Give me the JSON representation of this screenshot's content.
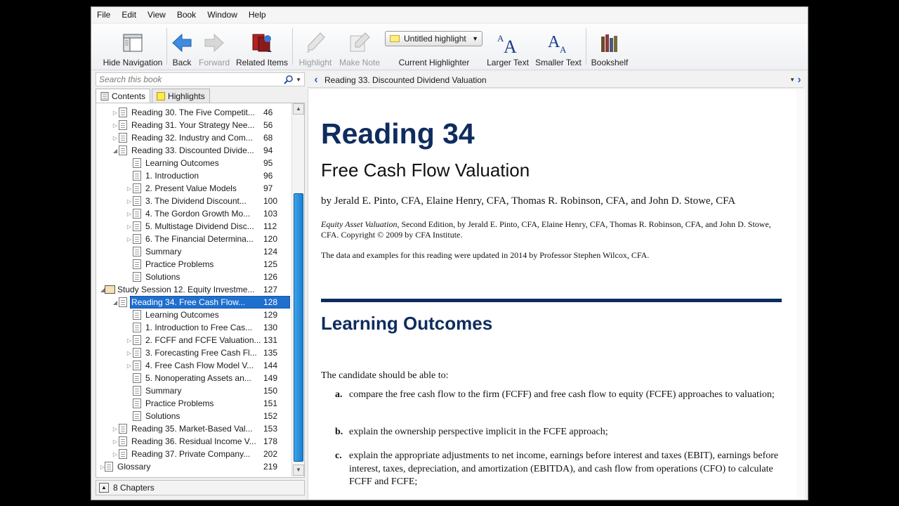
{
  "menu": [
    "File",
    "Edit",
    "View",
    "Book",
    "Window",
    "Help"
  ],
  "toolbar": {
    "hide_navigation": "Hide Navigation",
    "back": "Back",
    "forward": "Forward",
    "related_items": "Related Items",
    "highlight": "Highlight",
    "make_note": "Make Note",
    "highlighter_value": "Untitled highlight",
    "current_highlighter": "Current Highlighter",
    "larger_text": "Larger Text",
    "smaller_text": "Smaller Text",
    "bookshelf": "Bookshelf"
  },
  "sidebar": {
    "search_placeholder": "Search this book",
    "tabs": [
      "Contents",
      "Highlights"
    ],
    "status": "8 Chapters",
    "rows": [
      {
        "label": "Reading 30. The Five Competit...",
        "page": "46",
        "level": 2,
        "exp": "▷"
      },
      {
        "label": "Reading 31. Your Strategy Nee...",
        "page": "56",
        "level": 2,
        "exp": "▷"
      },
      {
        "label": "Reading 32. Industry and Com...",
        "page": "68",
        "level": 2,
        "exp": "▷"
      },
      {
        "label": "Reading 33. Discounted Divide...",
        "page": "94",
        "level": 2,
        "exp": "◢"
      },
      {
        "label": "Learning Outcomes",
        "page": "95",
        "level": 3,
        "exp": ""
      },
      {
        "label": "1. Introduction",
        "page": "96",
        "level": 3,
        "exp": ""
      },
      {
        "label": "2. Present Value Models",
        "page": "97",
        "level": 3,
        "exp": "▷"
      },
      {
        "label": "3. The Dividend Discount...",
        "page": "100",
        "level": 3,
        "exp": "▷"
      },
      {
        "label": "4. The Gordon Growth Mo...",
        "page": "103",
        "level": 3,
        "exp": "▷"
      },
      {
        "label": "5. Multistage Dividend Disc...",
        "page": "112",
        "level": 3,
        "exp": "▷"
      },
      {
        "label": "6. The Financial Determina...",
        "page": "120",
        "level": 3,
        "exp": "▷"
      },
      {
        "label": "Summary",
        "page": "124",
        "level": 3,
        "exp": ""
      },
      {
        "label": "Practice Problems",
        "page": "125",
        "level": 3,
        "exp": ""
      },
      {
        "label": "Solutions",
        "page": "126",
        "level": 3,
        "exp": ""
      },
      {
        "label": "Study Session 12. Equity Investme...",
        "page": "127",
        "level": 1,
        "exp": "◢",
        "book": true
      },
      {
        "label": "Reading 34. Free Cash Flow...",
        "page": "128",
        "level": 2,
        "exp": "◢",
        "selected": true
      },
      {
        "label": "Learning Outcomes",
        "page": "129",
        "level": 3,
        "exp": ""
      },
      {
        "label": "1. Introduction to Free Cas...",
        "page": "130",
        "level": 3,
        "exp": ""
      },
      {
        "label": "2. FCFF and FCFE Valuation...",
        "page": "131",
        "level": 3,
        "exp": "▷"
      },
      {
        "label": "3. Forecasting Free Cash Fl...",
        "page": "135",
        "level": 3,
        "exp": "▷"
      },
      {
        "label": "4. Free Cash Flow Model V...",
        "page": "144",
        "level": 3,
        "exp": "▷"
      },
      {
        "label": "5. Nonoperating Assets an...",
        "page": "149",
        "level": 3,
        "exp": ""
      },
      {
        "label": "Summary",
        "page": "150",
        "level": 3,
        "exp": ""
      },
      {
        "label": "Practice Problems",
        "page": "151",
        "level": 3,
        "exp": ""
      },
      {
        "label": "Solutions",
        "page": "152",
        "level": 3,
        "exp": ""
      },
      {
        "label": "Reading 35. Market-Based Val...",
        "page": "153",
        "level": 2,
        "exp": "▷"
      },
      {
        "label": "Reading 36. Residual Income V...",
        "page": "178",
        "level": 2,
        "exp": "▷"
      },
      {
        "label": "Reading 37. Private Company...",
        "page": "202",
        "level": 2,
        "exp": "▷"
      },
      {
        "label": "Glossary",
        "page": "219",
        "level": 1,
        "exp": "▷"
      }
    ]
  },
  "navbar": {
    "location": "Reading 33. Discounted Dividend Valuation"
  },
  "content": {
    "heading": "Reading 34",
    "subheading": "Free Cash Flow Valuation",
    "authors": "by Jerald E. Pinto, CFA, Elaine Henry, CFA, Thomas R. Robinson, CFA, and John D. Stowe, CFA",
    "cite_title": "Equity Asset Valuation",
    "cite_rest": ", Second Edition, by Jerald E. Pinto, CFA, Elaine Henry, CFA, Thomas R. Robinson, CFA, and John D. Stowe, CFA. Copyright © 2009 by CFA Institute.",
    "updated": "The data and examples for this reading were updated in 2014 by Professor Stephen Wilcox, CFA.",
    "section_title": "Learning Outcomes",
    "intro": "The candidate should be able to:",
    "outcomes": [
      {
        "letter": "a.",
        "text": "compare the free cash flow to the firm (FCFF) and free cash flow to equity (FCFE) approaches to valuation;"
      },
      {
        "letter": "b.",
        "text": "explain the ownership perspective implicit in the FCFE approach;"
      },
      {
        "letter": "c.",
        "text": "explain the appropriate adjustments to net income, earnings before interest and taxes (EBIT), earnings before interest, taxes, depreciation, and amortization (EBITDA), and cash flow from operations (CFO) to calculate FCFF and FCFE;"
      }
    ]
  },
  "colors": {
    "heading": "#0f2c5e",
    "selection": "#1f6fce",
    "scroll_thumb": "#1b7fd0"
  }
}
